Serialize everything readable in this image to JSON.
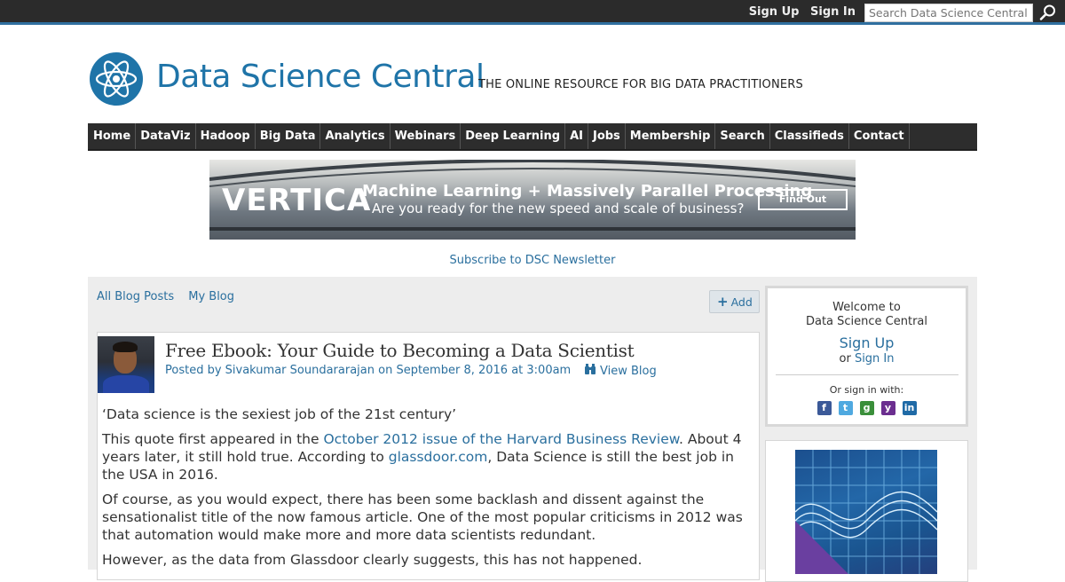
{
  "topbar": {
    "sign_up": "Sign Up",
    "sign_in": "Sign In",
    "search_placeholder": "Search Data Science Central"
  },
  "header": {
    "site_name": "Data Science Central",
    "tagline": "THE ONLINE RESOURCE FOR BIG DATA PRACTITIONERS"
  },
  "nav": {
    "items": [
      "Home",
      "DataViz",
      "Hadoop",
      "Big Data",
      "Analytics",
      "Webinars",
      "Deep Learning",
      "AI",
      "Jobs",
      "Membership",
      "Search",
      "Classifieds",
      "Contact"
    ]
  },
  "banner": {
    "brand": "VERTICA",
    "headline": "Machine Learning + Massively Parallel Processing",
    "subline": "Are you ready for the new speed and scale of business?",
    "cta": "Find Out"
  },
  "newsletter": "Subscribe to DSC Newsletter",
  "blog_links": {
    "all": "All Blog Posts",
    "mine": "My Blog",
    "add": "Add"
  },
  "post": {
    "title": "Free Ebook: Your Guide to Becoming a Data Scientist",
    "meta": "Posted by Sivakumar Soundararajan on September 8, 2016 at 3:00am",
    "view_blog": "View Blog",
    "p1": "‘Data science is the sexiest job of the 21st century’",
    "p2_a": "This quote first appeared in the ",
    "p2_link1": "October 2012 issue of the Harvard Business Review",
    "p2_b": ". About 4 years later, it still hold true. According to ",
    "p2_link2": "glassdoor.com",
    "p2_c": ", Data Science is still the best job in the USA in 2016.",
    "p3": "Of course, as you would expect, there has been some backlash and dissent against the sensationalist title of the now famous article. One of the most popular criticisms in 2012 was that automation would make more and more data scientists redundant.",
    "p4": "However, as the data from Glassdoor clearly suggests, this has not happened."
  },
  "signin": {
    "welcome_1": "Welcome to",
    "welcome_2": "Data Science Central",
    "sign_up": "Sign Up",
    "or": "or",
    "sign_in": "Sign In",
    "other": "Or sign in with:",
    "providers": [
      {
        "name": "facebook-icon",
        "glyph": "f",
        "color": "#3b5998"
      },
      {
        "name": "twitter-icon",
        "glyph": "t",
        "color": "#4fa9e0"
      },
      {
        "name": "google-icon",
        "glyph": "g",
        "color": "#3a8f3a"
      },
      {
        "name": "yahoo-icon",
        "glyph": "y",
        "color": "#6b2e8f"
      },
      {
        "name": "linkedin-icon",
        "glyph": "in",
        "color": "#1f6aa6"
      }
    ]
  }
}
